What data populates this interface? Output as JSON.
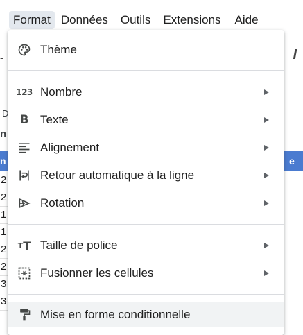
{
  "menubar": {
    "items": [
      "Format",
      "Données",
      "Outils",
      "Extensions",
      "Aide"
    ],
    "active_index": 0
  },
  "background": {
    "row_cells": [
      "2",
      "2",
      "1",
      "1",
      "2",
      "2",
      "3",
      "3"
    ],
    "header_right_text": "e",
    "header_left_text": "n",
    "top_left_text": "n",
    "side_letter": "D"
  },
  "menu": {
    "items": [
      {
        "label": "Thème",
        "icon": "palette-icon",
        "submenu": false
      },
      {
        "label": "Nombre",
        "icon": "number-123-icon",
        "submenu": true
      },
      {
        "label": "Texte",
        "icon": "bold-icon",
        "submenu": true
      },
      {
        "label": "Alignement",
        "icon": "align-left-icon",
        "submenu": true
      },
      {
        "label": "Retour automatique à la ligne",
        "icon": "text-wrap-icon",
        "submenu": true
      },
      {
        "label": "Rotation",
        "icon": "text-rotation-icon",
        "submenu": true
      },
      {
        "label": "Taille de police",
        "icon": "font-size-icon",
        "submenu": true
      },
      {
        "label": "Fusionner les cellules",
        "icon": "merge-cells-icon",
        "submenu": true
      },
      {
        "label": "Mise en forme conditionnelle",
        "icon": "paint-roller-icon",
        "submenu": false
      }
    ]
  },
  "colors": {
    "menubar_active_bg": "#e3e8ee",
    "hover_bg": "#f1f3f4",
    "header_blue": "#4a7bd0",
    "separator": "#dadce0",
    "icon": "#444746"
  }
}
